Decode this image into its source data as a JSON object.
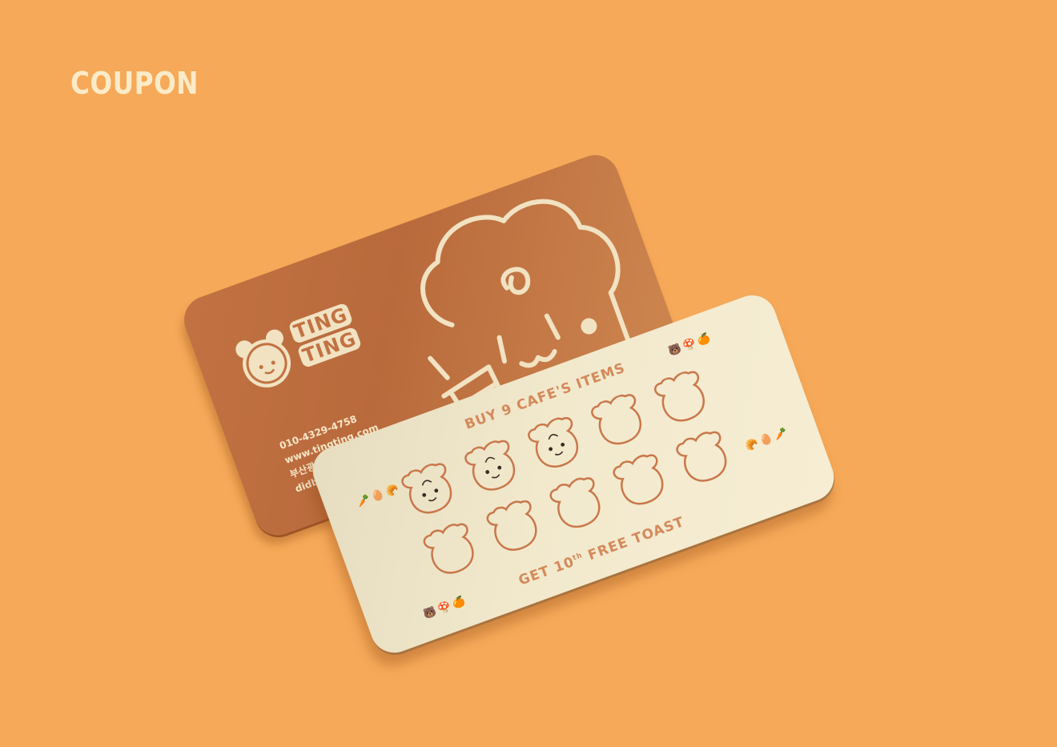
{
  "title": "COUPON",
  "back_card": {
    "logo_line1": "TING",
    "logo_line2": "TING",
    "phone": "010-4329-4758",
    "website": "www.tingting.com",
    "address": "부산광역시 부산진구 신천대로 7",
    "email": "didbstn719@naver.com"
  },
  "front_card": {
    "headline": "BUY 9 CAFE'S ITEMS",
    "footer_prefix": "GET 10",
    "footer_sup": "th",
    "footer_suffix": " FREE TOAST",
    "stamps_filled": 3,
    "stamps_total": 10
  },
  "colors": {
    "background": "#F6A958",
    "card_back": "#C27242",
    "card_front": "#F2E9CD",
    "accent": "#D4895A",
    "title": "#FBEBC8"
  }
}
